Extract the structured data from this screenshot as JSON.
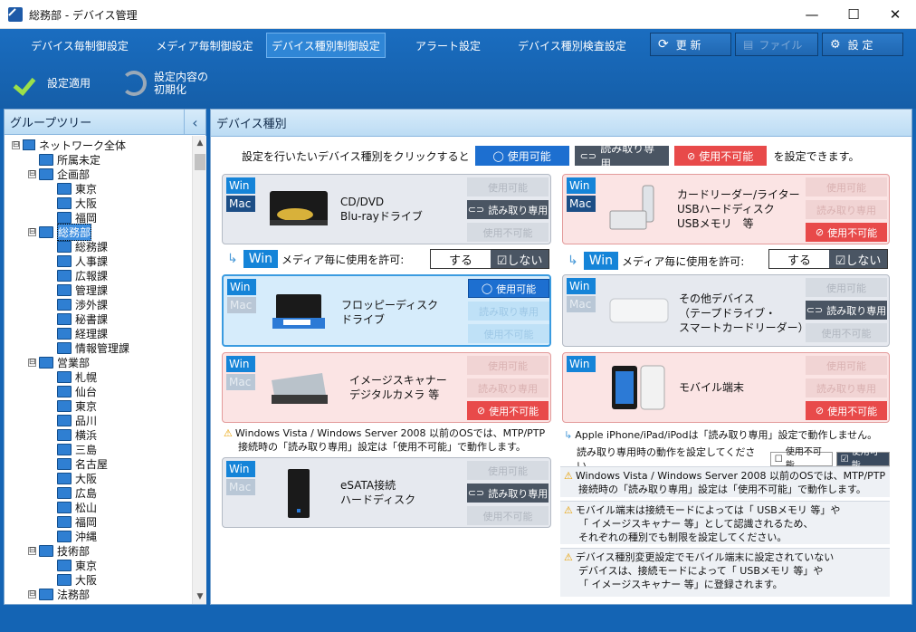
{
  "window": {
    "title": "総務部 - デバイス管理",
    "minimize": "—",
    "maximize": "☐",
    "close": "✕"
  },
  "tabs": [
    {
      "label": "デバイス毎制御設定",
      "active": false
    },
    {
      "label": "メディア毎制御設定",
      "active": false
    },
    {
      "label": "デバイス種別制御設定",
      "active": true
    },
    {
      "label": "アラート設定",
      "active": false
    },
    {
      "label": "デバイス種別検査設定",
      "active": false
    }
  ],
  "toolbar": {
    "refresh": "更 新",
    "file": "ファイル",
    "settings": "設 定",
    "apply": "設定適用",
    "reset_line1": "設定内容の",
    "reset_line2": "初期化"
  },
  "left": {
    "title": "グループツリー",
    "collapse": "‹"
  },
  "tree": [
    {
      "label": "ネットワーク全体",
      "level": 0,
      "type": "root",
      "expander": "⊟"
    },
    {
      "label": "所属未定",
      "level": 1,
      "type": "folder"
    },
    {
      "label": "企画部",
      "level": 1,
      "type": "folder",
      "expander": "⊟"
    },
    {
      "label": "東京",
      "level": 2,
      "type": "folder"
    },
    {
      "label": "大阪",
      "level": 2,
      "type": "folder"
    },
    {
      "label": "福岡",
      "level": 2,
      "type": "folder"
    },
    {
      "label": "総務部",
      "level": 1,
      "type": "folder",
      "expander": "⊟",
      "selected": true
    },
    {
      "label": "総務課",
      "level": 2,
      "type": "folder"
    },
    {
      "label": "人事課",
      "level": 2,
      "type": "folder"
    },
    {
      "label": "広報課",
      "level": 2,
      "type": "folder"
    },
    {
      "label": "管理課",
      "level": 2,
      "type": "folder"
    },
    {
      "label": "渉外課",
      "level": 2,
      "type": "folder"
    },
    {
      "label": "秘書課",
      "level": 2,
      "type": "folder"
    },
    {
      "label": "経理課",
      "level": 2,
      "type": "folder"
    },
    {
      "label": "情報管理課",
      "level": 2,
      "type": "folder"
    },
    {
      "label": "営業部",
      "level": 1,
      "type": "folder",
      "expander": "⊟"
    },
    {
      "label": "札幌",
      "level": 2,
      "type": "folder"
    },
    {
      "label": "仙台",
      "level": 2,
      "type": "folder"
    },
    {
      "label": "東京",
      "level": 2,
      "type": "folder"
    },
    {
      "label": "品川",
      "level": 2,
      "type": "folder"
    },
    {
      "label": "横浜",
      "level": 2,
      "type": "folder"
    },
    {
      "label": "三島",
      "level": 2,
      "type": "folder"
    },
    {
      "label": "名古屋",
      "level": 2,
      "type": "folder"
    },
    {
      "label": "大阪",
      "level": 2,
      "type": "folder"
    },
    {
      "label": "広島",
      "level": 2,
      "type": "folder"
    },
    {
      "label": "松山",
      "level": 2,
      "type": "folder"
    },
    {
      "label": "福岡",
      "level": 2,
      "type": "folder"
    },
    {
      "label": "沖縄",
      "level": 2,
      "type": "folder"
    },
    {
      "label": "技術部",
      "level": 1,
      "type": "folder",
      "expander": "⊟"
    },
    {
      "label": "東京",
      "level": 2,
      "type": "folder"
    },
    {
      "label": "大阪",
      "level": 2,
      "type": "folder"
    },
    {
      "label": "法務部",
      "level": 1,
      "type": "folder",
      "expander": "⊟"
    }
  ],
  "right": {
    "title": "デバイス種別"
  },
  "instruction": {
    "prefix": "設定を行いたいデバイス種別をクリックすると",
    "usable": "使用可能",
    "readonly": "読み取り専用",
    "unusable": "使用不可能",
    "suffix": "を設定できます。"
  },
  "states": {
    "usable": "使用可能",
    "readonly": "読み取り専用",
    "unusable": "使用不可能"
  },
  "badges": {
    "win": "Win",
    "mac": "Mac"
  },
  "devices": [
    {
      "id": "cddvd",
      "name1": "CD/DVD",
      "name2": "Blu-rayドライブ",
      "name3": "",
      "state": "readonly"
    },
    {
      "id": "floppy",
      "name1": "フロッピーディスク",
      "name2": "ドライブ",
      "name3": "",
      "state": "usable"
    },
    {
      "id": "scanner",
      "name1": "イメージスキャナー",
      "name2": "デジタルカメラ 等",
      "name3": "",
      "state": "unusable"
    },
    {
      "id": "esata",
      "name1": "eSATA接続",
      "name2": "ハードディスク",
      "name3": "",
      "state": "readonly"
    },
    {
      "id": "card",
      "name1": "カードリーダー/ライター",
      "name2": "USBハードディスク",
      "name3": "USBメモリ　等",
      "state": "unusable"
    },
    {
      "id": "other",
      "name1": "その他デバイス",
      "name2": "（テープドライブ・",
      "name3": "スマートカードリーダー）",
      "state": "readonly"
    },
    {
      "id": "mobile",
      "name1": "モバイル端末",
      "name2": "",
      "name3": "",
      "state": "unusable"
    }
  ],
  "permit": {
    "win": "Win",
    "label": "メディア毎に使用を許可:",
    "yes": "する",
    "no": "☑しない"
  },
  "notes": {
    "vista_left_1": "Windows Vista / Windows Server 2008 以前のOSでは、MTP/PTP",
    "vista_left_2": "接続時の「読み取り専用」設定は「使用不可能」で動作します。",
    "apple_1": "Apple iPhone/iPad/iPodは「読み取り専用」設定で動作しません。",
    "apple_2": "読み取り専用時の動作を設定してください。",
    "apple_opt1": "使用不可能",
    "apple_opt2": "使用可能",
    "vista_right_1": "Windows Vista / Windows Server 2008 以前のOSでは、MTP/PTP",
    "vista_right_2": "接続時の「読み取り専用」設定は「使用不可能」で動作します。",
    "mobile_1": "モバイル端末は接続モードによっては「 USBメモリ 等」や",
    "mobile_2": "「 イメージスキャナー 等」として認識されるため、",
    "mobile_3": "それぞれの種別でも制限を設定してください。",
    "change_1": "デバイス種別変更設定でモバイル端末に設定されていない",
    "change_2": "デバイスは、接続モードによって「 USBメモリ 等」や",
    "change_3": "「 イメージスキャナー 等」に登録されます。"
  },
  "colors": {
    "usable": "#1d6fd0",
    "readonly": "#4a5563",
    "unusable": "#e84a4a",
    "accent": "#1464b4"
  }
}
